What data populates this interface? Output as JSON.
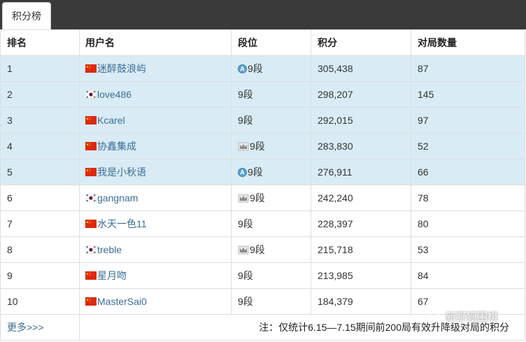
{
  "tab": {
    "label": "积分榜"
  },
  "columns": [
    "排名",
    "用户名",
    "段位",
    "积分",
    "对局数量"
  ],
  "rows": [
    {
      "rank": "1",
      "flag": "china-flag-icon",
      "name": "迷醉鼓浪屿",
      "badge": "a-badge-icon",
      "dan": "9段",
      "score": "305,438",
      "games": "87",
      "highlight": true
    },
    {
      "rank": "2",
      "flag": "korea-flag-icon",
      "name": "love486",
      "badge": "",
      "dan": "9段",
      "score": "298,207",
      "games": "145",
      "highlight": true
    },
    {
      "rank": "3",
      "flag": "china-flag-icon",
      "name": "Kcarel",
      "badge": "",
      "dan": "9段",
      "score": "292,015",
      "games": "97",
      "highlight": true
    },
    {
      "rank": "4",
      "flag": "china-flag-icon",
      "name": "协鑫集成",
      "badge": "crown-badge-icon",
      "dan": "9段",
      "score": "283,830",
      "games": "52",
      "highlight": true
    },
    {
      "rank": "5",
      "flag": "china-flag-icon",
      "name": "我是小秋语",
      "badge": "a-badge-icon",
      "dan": "9段",
      "score": "276,911",
      "games": "66",
      "highlight": true
    },
    {
      "rank": "6",
      "flag": "korea-flag-icon",
      "name": "gangnam",
      "badge": "crown-badge-icon",
      "dan": "9段",
      "score": "242,240",
      "games": "78",
      "highlight": false
    },
    {
      "rank": "7",
      "flag": "china-flag-icon",
      "name": "水天一色11",
      "badge": "",
      "dan": "9段",
      "score": "228,397",
      "games": "80",
      "highlight": false
    },
    {
      "rank": "8",
      "flag": "korea-flag-icon",
      "name": "treble",
      "badge": "crown-badge-icon",
      "dan": "9段",
      "score": "215,718",
      "games": "53",
      "highlight": false
    },
    {
      "rank": "9",
      "flag": "china-flag-icon",
      "name": "星月吻",
      "badge": "",
      "dan": "9段",
      "score": "213,985",
      "games": "84",
      "highlight": false
    },
    {
      "rank": "10",
      "flag": "china-flag-icon",
      "name": "MasterSai0",
      "badge": "",
      "dan": "9段",
      "score": "184,379",
      "games": "67",
      "highlight": false
    }
  ],
  "footer": {
    "more": "更多>>>",
    "note": "注：仅统计6.15—7.15期间前200局有效升降级对局的积分"
  },
  "watermark": {
    "text": "新野狐围棋"
  },
  "colors": {
    "topbar": "#3a3a3a",
    "highlight_row": "#d9ecf5",
    "link": "#3a6e96",
    "border": "#dddddd"
  }
}
